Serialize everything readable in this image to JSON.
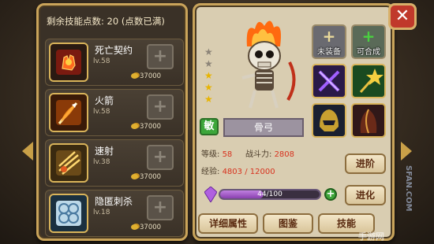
{
  "left_panel": {
    "header_label": "剩余技能点数:",
    "header_value": "20",
    "header_note": "(点数已满)",
    "skills": [
      {
        "name": "死亡契约",
        "level": "lv.58",
        "cost": "37000",
        "icon": "death-pact-icon"
      },
      {
        "name": "火箭",
        "level": "lv.58",
        "cost": "37000",
        "icon": "fire-arrow-icon"
      },
      {
        "name": "速射",
        "level": "lv.38",
        "cost": "37000",
        "icon": "rapid-shot-icon"
      },
      {
        "name": "隐匿刺杀",
        "level": "lv.18",
        "cost": "37000",
        "icon": "stealth-strike-icon"
      }
    ]
  },
  "hero": {
    "class_badge": "敏",
    "name": "骨弓",
    "stars_total": 5,
    "stars_filled": 3,
    "level_label": "等级:",
    "level_value": "58",
    "power_label": "战斗力:",
    "power_value": "2808",
    "exp_label": "经验:",
    "exp_value": "4803 / 12000",
    "shard_progress": "44/100",
    "shard_fraction": 0.44
  },
  "equipment": [
    {
      "label": "未装备",
      "plus": "+",
      "plus_color": "#e8d89a"
    },
    {
      "label": "可合成",
      "plus": "+",
      "plus_color": "#4ad040"
    },
    {
      "label": "",
      "icon": "crossed-blades-icon"
    },
    {
      "label": "",
      "icon": "golden-star-wand-icon"
    },
    {
      "label": "",
      "icon": "helmet-icon"
    },
    {
      "label": "",
      "icon": "cloak-icon"
    }
  ],
  "buttons": {
    "advance": "进阶",
    "evolve": "进化",
    "details": "详细属性",
    "codex": "图鉴",
    "skills": "技能"
  },
  "close": "✕",
  "watermark": "SFAN.COM",
  "watermark2": "手游网"
}
